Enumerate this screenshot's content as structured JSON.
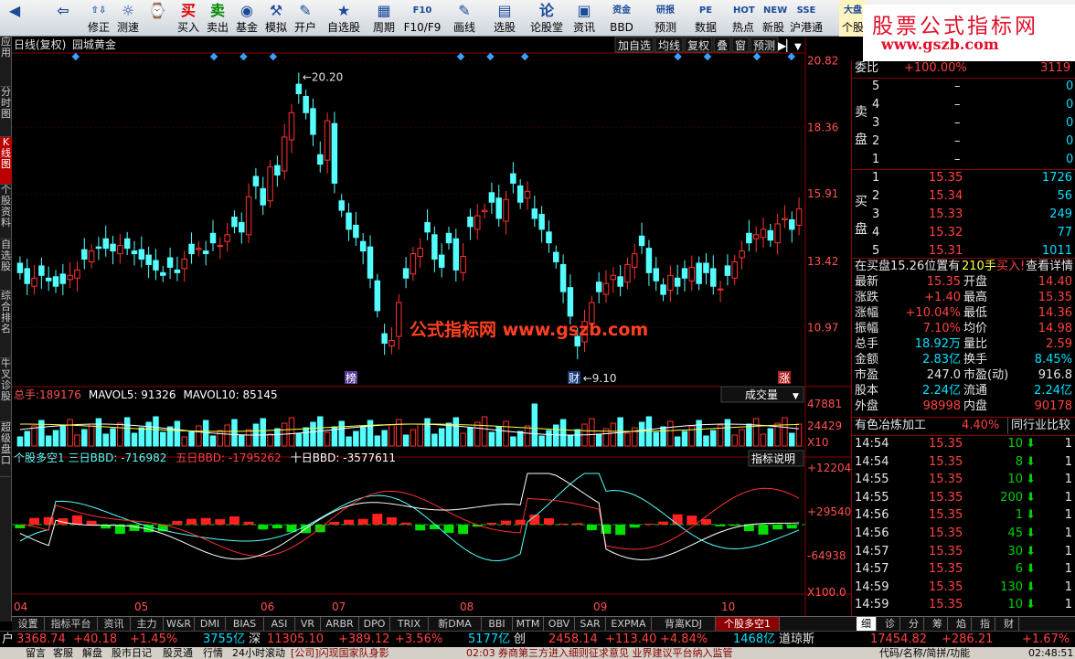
{
  "toolbar": {
    "items": [
      {
        "label": "",
        "icon": "◀"
      },
      {
        "label": "",
        "icon": "⇦"
      },
      {
        "label": "修正",
        "icon": "⇧⇩"
      },
      {
        "label": "测速",
        "icon": "☼"
      },
      {
        "label": "",
        "icon": "⌚"
      },
      {
        "label": "买入",
        "icon": "买"
      },
      {
        "label": "卖出",
        "icon": "卖"
      },
      {
        "label": "基金",
        "icon": "◉"
      },
      {
        "label": "模拟",
        "icon": "⚒"
      },
      {
        "label": "开户",
        "icon": "✎"
      },
      {
        "label": "自选股",
        "icon": "★"
      },
      {
        "label": "周期",
        "icon": "▦"
      },
      {
        "label": "F10/F9",
        "icon": "F10"
      },
      {
        "label": "画线",
        "icon": "✎"
      },
      {
        "label": "选股",
        "icon": "▤"
      },
      {
        "label": "论股堂",
        "icon": "论"
      },
      {
        "label": "资讯",
        "icon": "▣"
      },
      {
        "label": "BBD",
        "icon": "资金"
      },
      {
        "label": "预测",
        "icon": "研报"
      },
      {
        "label": "数据",
        "icon": "PE"
      },
      {
        "label": "热点",
        "icon": "HOT"
      },
      {
        "label": "新股",
        "icon": "NEW"
      },
      {
        "label": "沪港通",
        "icon": "SSE"
      },
      {
        "label": "个股",
        "icon": "大盘"
      }
    ]
  },
  "brand": {
    "line1": "股票公式指标网",
    "line2": "www.gszb.com"
  },
  "left_tabs": [
    "应用",
    "分时图",
    "K线图",
    "个股资料",
    "自选股",
    "综合排名",
    "牛叉诊股",
    "超级盘口"
  ],
  "chart": {
    "title": "日线(复权)",
    "stock": "园城黄金",
    "buttons": [
      "加自选",
      "均线",
      "复权",
      "叠",
      "窗",
      "预测"
    ],
    "price_ticks": [
      "20.82",
      "18.36",
      "15.91",
      "13.42",
      "10.97"
    ],
    "high_label": "20.20",
    "low_label": "9.10",
    "markers": [
      "榜",
      "财",
      "涨"
    ],
    "watermark": "公式指标网  www.gszb.com",
    "vol_header": {
      "label": "总手:",
      "value": "189176",
      "ma5": "MAVOL5: 91326",
      "ma10": "MAVOL10: 85145"
    },
    "vol_selector": "成交量",
    "vol_ticks": [
      "47881",
      "24429",
      "X10"
    ],
    "bbd_header": {
      "name": "个股多空1",
      "d3": "三日BBD: -716982",
      "d5": "五日BBD: -1795262",
      "d10": "十日BBD: -3577611"
    },
    "bbd_button": "指标说明",
    "bbd_ticks": [
      "+122049",
      "+29540",
      "-64938",
      "X100.0"
    ],
    "x_labels": [
      "04",
      "05",
      "06",
      "07",
      "08",
      "09",
      "10"
    ]
  },
  "chart_data": {
    "type": "candlestick",
    "title": "园城黄金 日线(复权)",
    "ylim": [
      8.9,
      21.1
    ],
    "categories": [
      "04",
      "05",
      "06",
      "07",
      "08",
      "09",
      "10"
    ],
    "close": [
      13.0,
      12.6,
      12.8,
      12.9,
      12.7,
      12.5,
      12.6,
      12.9,
      13.1,
      13.5,
      13.8,
      13.9,
      13.9,
      13.8,
      14.0,
      13.9,
      13.7,
      13.5,
      13.3,
      13.1,
      12.9,
      13.2,
      13.0,
      13.5,
      13.7,
      13.9,
      13.7,
      14.1,
      14.0,
      14.4,
      14.7,
      14.5,
      15.8,
      16.2,
      15.5,
      16.9,
      16.6,
      18.0,
      18.9,
      19.6,
      18.9,
      18.1,
      17.0,
      18.6,
      16.3,
      15.3,
      14.6,
      14.3,
      13.8,
      12.8,
      11.6,
      10.4,
      10.5,
      11.9,
      12.8,
      13.7,
      13.9,
      14.5,
      13.5,
      13.2,
      14.1,
      13.1,
      13.6,
      14.7,
      15.1,
      15.3,
      15.6,
      15.0,
      15.7,
      16.3,
      15.6,
      16.0,
      15.0,
      14.6,
      14.1,
      13.4,
      12.3,
      11.4,
      10.3,
      11.2,
      11.9,
      12.3,
      12.6,
      12.9,
      12.5,
      13.3,
      13.7,
      14.0,
      13.0,
      12.7,
      12.2,
      12.9,
      12.5,
      12.8,
      13.2,
      12.6,
      13.0,
      12.5,
      12.4,
      12.9,
      13.4,
      13.8,
      14.1,
      14.4,
      14.6,
      14.2,
      14.8,
      15.0,
      14.6,
      15.35
    ],
    "volume_max": 47881,
    "bbd_ylim": [
      -64938,
      122049
    ],
    "series_labels": [
      "三日BBD",
      "五日BBD",
      "十日BBD"
    ]
  },
  "order_book": {
    "webi": {
      "label": "委比",
      "pct": "+100.00%",
      "num": "3119"
    },
    "sell_label": [
      "卖",
      "盘"
    ],
    "buy_label": [
      "买",
      "盘"
    ],
    "sell": [
      {
        "lvl": "5",
        "price": "–",
        "vol": "0"
      },
      {
        "lvl": "4",
        "price": "–",
        "vol": "0"
      },
      {
        "lvl": "3",
        "price": "–",
        "vol": "0"
      },
      {
        "lvl": "2",
        "price": "–",
        "vol": "0"
      },
      {
        "lvl": "1",
        "price": "–",
        "vol": "0"
      }
    ],
    "buy": [
      {
        "lvl": "1",
        "price": "15.35",
        "vol": "1726"
      },
      {
        "lvl": "2",
        "price": "15.34",
        "vol": "56"
      },
      {
        "lvl": "3",
        "price": "15.33",
        "vol": "249"
      },
      {
        "lvl": "4",
        "price": "15.32",
        "vol": "77"
      },
      {
        "lvl": "5",
        "price": "15.31",
        "vol": "1011"
      }
    ]
  },
  "position_bar": {
    "text": "在买盘15.26位置有",
    "hand": "210手",
    "action": "买入!",
    "link": "查看详情"
  },
  "quote": [
    {
      "k1": "最新",
      "v1": "15.35",
      "k2": "开盘",
      "v2": "14.40"
    },
    {
      "k1": "涨跌",
      "v1": "+1.40",
      "k2": "最高",
      "v2": "15.35"
    },
    {
      "k1": "涨幅",
      "v1": "+10.04%",
      "k2": "最低",
      "v2": "14.36"
    },
    {
      "k1": "振幅",
      "v1": "7.10%",
      "k2": "均价",
      "v2": "14.98"
    },
    {
      "k1": "总手",
      "v1": "18.92万",
      "k2": "量比",
      "v2": "2.59"
    },
    {
      "k1": "金额",
      "v1": "2.83亿",
      "k2": "换手",
      "v2": "8.45%"
    },
    {
      "k1": "市盈",
      "v1": "247.0",
      "k2": "市盈(动)",
      "v2": "916.8"
    },
    {
      "k1": "股本",
      "v1": "2.24亿",
      "k2": "流通",
      "v2": "2.24亿"
    },
    {
      "k1": "外盘",
      "v1": "98998",
      "k2": "内盘",
      "v2": "90178"
    }
  ],
  "industry": {
    "name": "有色冶炼加工",
    "pct": "4.40%",
    "btn": "同行业比较"
  },
  "ticks": [
    {
      "t": "14:54",
      "p": "15.35",
      "v": "10",
      "c": "1"
    },
    {
      "t": "14:54",
      "p": "15.35",
      "v": "8",
      "c": "1"
    },
    {
      "t": "14:55",
      "p": "15.35",
      "v": "10",
      "c": "1"
    },
    {
      "t": "14:55",
      "p": "15.35",
      "v": "200",
      "c": "1"
    },
    {
      "t": "14:56",
      "p": "15.35",
      "v": "1",
      "c": "1"
    },
    {
      "t": "14:56",
      "p": "15.35",
      "v": "45",
      "c": "1"
    },
    {
      "t": "14:57",
      "p": "15.35",
      "v": "30",
      "c": "1"
    },
    {
      "t": "14:57",
      "p": "15.35",
      "v": "6",
      "c": "1"
    },
    {
      "t": "14:59",
      "p": "15.35",
      "v": "130",
      "c": "1"
    },
    {
      "t": "14:59",
      "p": "15.35",
      "v": "10",
      "c": "1"
    }
  ],
  "right_tabs": [
    "细",
    "诊",
    "分",
    "筹",
    "焰",
    "指",
    "财"
  ],
  "bottom_tabs": [
    "设置",
    "指标平台",
    "资讯",
    "主力",
    "W&R",
    "DMI",
    "BIAS",
    "ASI",
    "VR",
    "ARBR",
    "DPO",
    "TRIX",
    "新DMA",
    "BBI",
    "MTM",
    "OBV",
    "SAR",
    "EXPMA",
    "背离KDJ",
    "个股多空1"
  ],
  "ticker": {
    "a": "户",
    "b": "3368.74",
    "c": "+40.18",
    "d": "+1.45%",
    "e": "3755亿",
    "f": "深",
    "g": "11305.10",
    "h": "+389.12",
    "i": "+3.56%",
    "j": "5177亿",
    "k": "创",
    "l": "2458.14",
    "m": "+113.40",
    "n": "+4.84%",
    "o": "1468亿",
    "p": "道琼斯",
    "q": "17454.82",
    "r": "+286.21",
    "s": "+1.67%"
  },
  "status": {
    "a": "留言",
    "b": "客服",
    "c": "解盘",
    "d": "股市日记",
    "e": "股灵通",
    "f": "行情",
    "g": "24小时滚动",
    "h": "[公司]闪现国家队身影",
    "i": "02:03",
    "j": "券商第三方进入细则征求意见 业界建议平台纳入监管",
    "k": "代码/名称/简拼/功能",
    "l": "02:48:51"
  }
}
